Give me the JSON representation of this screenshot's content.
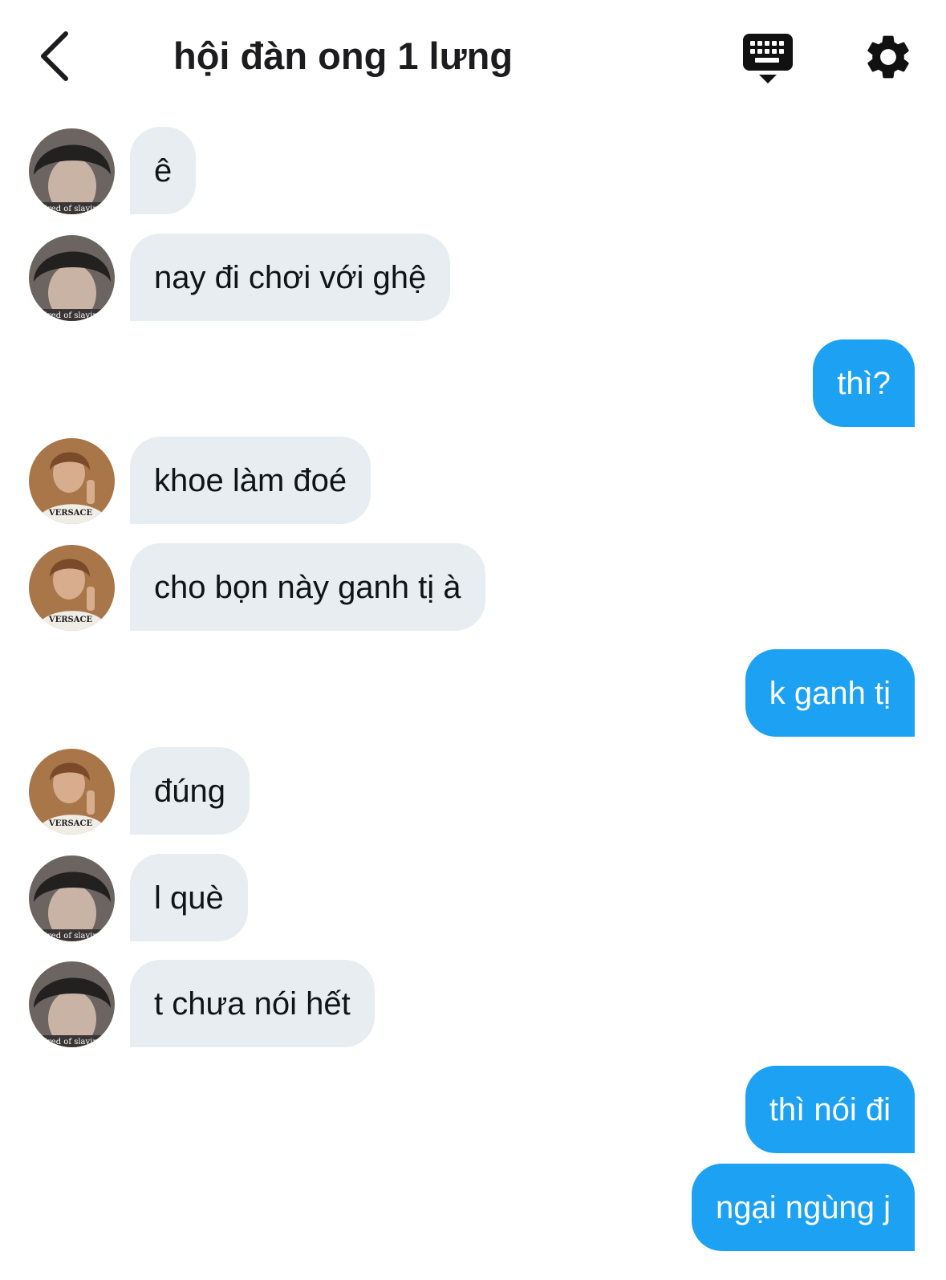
{
  "header": {
    "title": "hội đàn ong 1 lưng",
    "back_icon": "chevron-left-icon",
    "keyboard_icon": "keyboard-dismiss-icon",
    "settings_icon": "gear-icon"
  },
  "colors": {
    "incoming_bubble": "#e8edf1",
    "outgoing_bubble": "#1da1f2",
    "text_dark": "#0f1419"
  },
  "avatars": {
    "a": {
      "caption": "tired of slaying"
    },
    "b": {
      "caption": "VERSACE"
    }
  },
  "messages": [
    {
      "direction": "incoming",
      "sender_avatar": "a",
      "text": "ê"
    },
    {
      "direction": "incoming",
      "sender_avatar": "a",
      "text": "nay đi chơi với ghệ"
    },
    {
      "direction": "outgoing",
      "text": "thì?"
    },
    {
      "direction": "incoming",
      "sender_avatar": "b",
      "text": "khoe làm đoé"
    },
    {
      "direction": "incoming",
      "sender_avatar": "b",
      "text": "cho bọn này ganh tị à"
    },
    {
      "direction": "outgoing",
      "text": "k ganh tị"
    },
    {
      "direction": "incoming",
      "sender_avatar": "b",
      "text": "đúng"
    },
    {
      "direction": "incoming",
      "sender_avatar": "a",
      "text": "l què"
    },
    {
      "direction": "incoming",
      "sender_avatar": "a",
      "text": "t chưa nói hết"
    },
    {
      "direction": "outgoing",
      "text": "thì nói đi"
    },
    {
      "direction": "outgoing",
      "text": "ngại ngùng j"
    }
  ]
}
